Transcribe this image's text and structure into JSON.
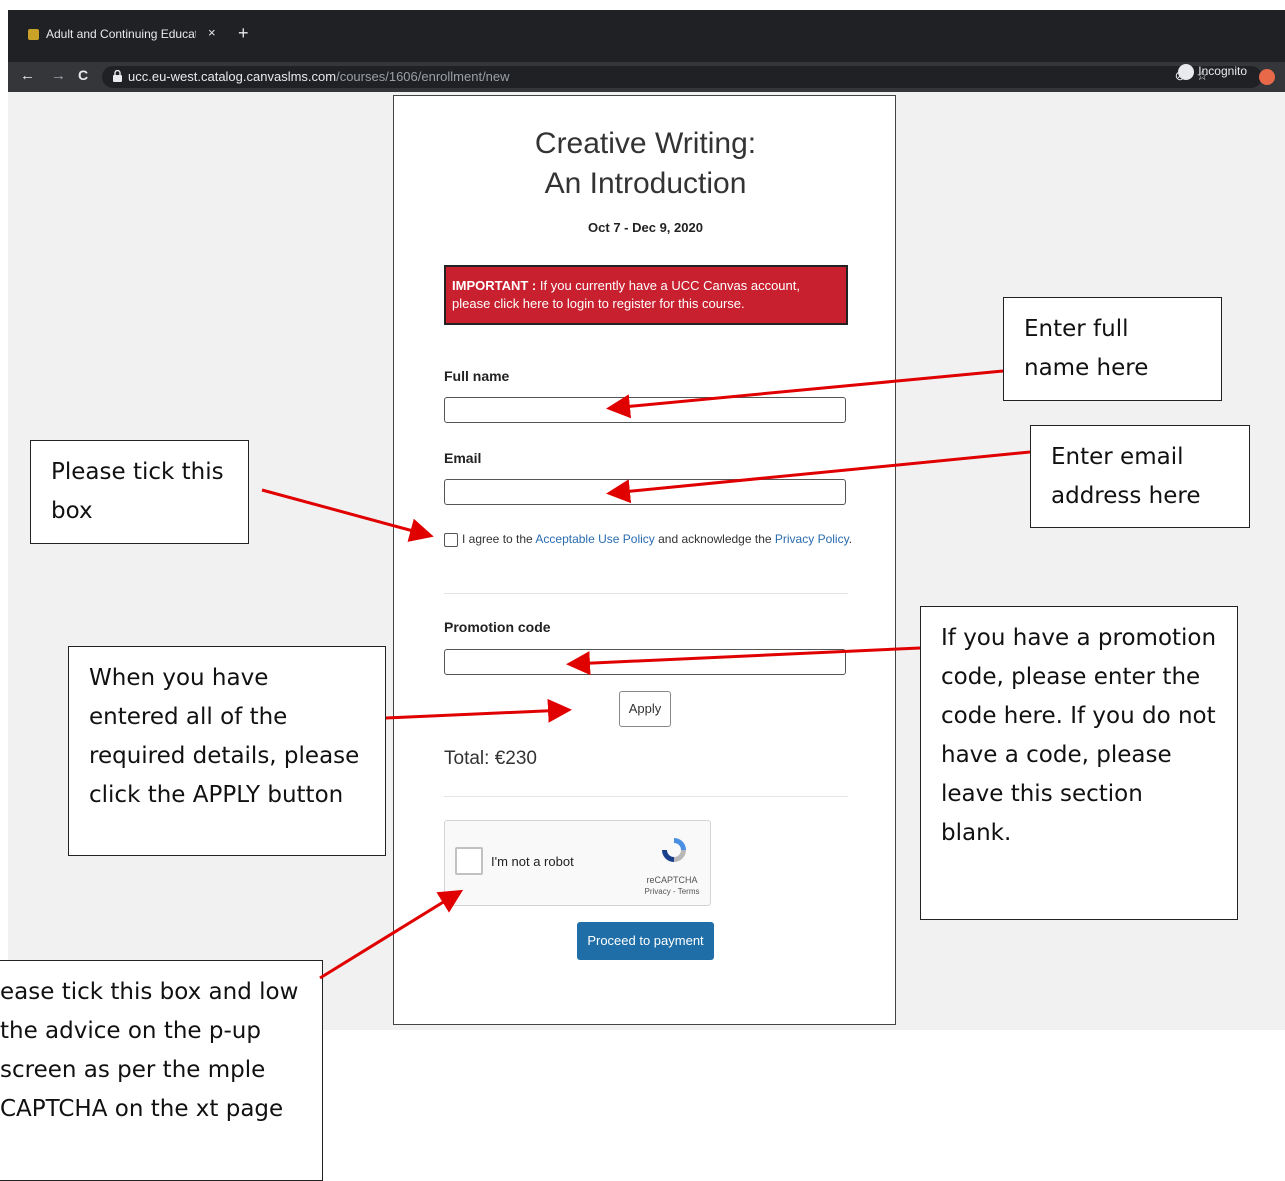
{
  "browser": {
    "tab_title": "Adult and Continuing Educatio",
    "tab_close": "×",
    "new_tab": "+",
    "back": "←",
    "forward": "→",
    "reload": "C",
    "url_host": "ucc.eu-west.catalog.canvaslms.com",
    "url_path": "/courses/1606/enrollment/new",
    "star": "☆",
    "incognito_label": "Incognito"
  },
  "page": {
    "course_title": "Creative Writing: An Introduction",
    "dates": "Oct 7 - Dec 9, 2020",
    "alert_strong": "IMPORTANT :",
    "alert_text": "If you currently have a UCC Canvas account, please click here to login to register for this course.",
    "full_name_label": "Full name",
    "email_label": "Email",
    "agree_prefix": "I agree to the",
    "aup_link": "Acceptable Use Policy",
    "agree_middle": "and acknowledge the",
    "privacy_link": "Privacy Policy",
    "agree_suffix": ".",
    "promo_label": "Promotion code",
    "apply_label": "Apply",
    "total": "Total: €230",
    "captcha_text": "I'm not a robot",
    "captcha_brand": "reCAPTCHA",
    "captcha_terms": "Privacy - Terms",
    "proceed_label": "Proceed to payment"
  },
  "callouts": {
    "full_name": "Enter full name here",
    "email": "Enter email address here",
    "tick": "Please tick this box",
    "apply": "When you have entered all of the required details, please click the APPLY button",
    "promo": "If you have a promotion code, please enter the code here. If you do not have a code, please leave this section blank.",
    "captcha": "ease tick this box and low the advice on the p-up screen as per the mple CAPTCHA on the xt page"
  },
  "colors": {
    "alert_bg": "#c8202f",
    "button_blue": "#1f6ea8",
    "link": "#2a6bb0",
    "arrow": "#e00000"
  }
}
